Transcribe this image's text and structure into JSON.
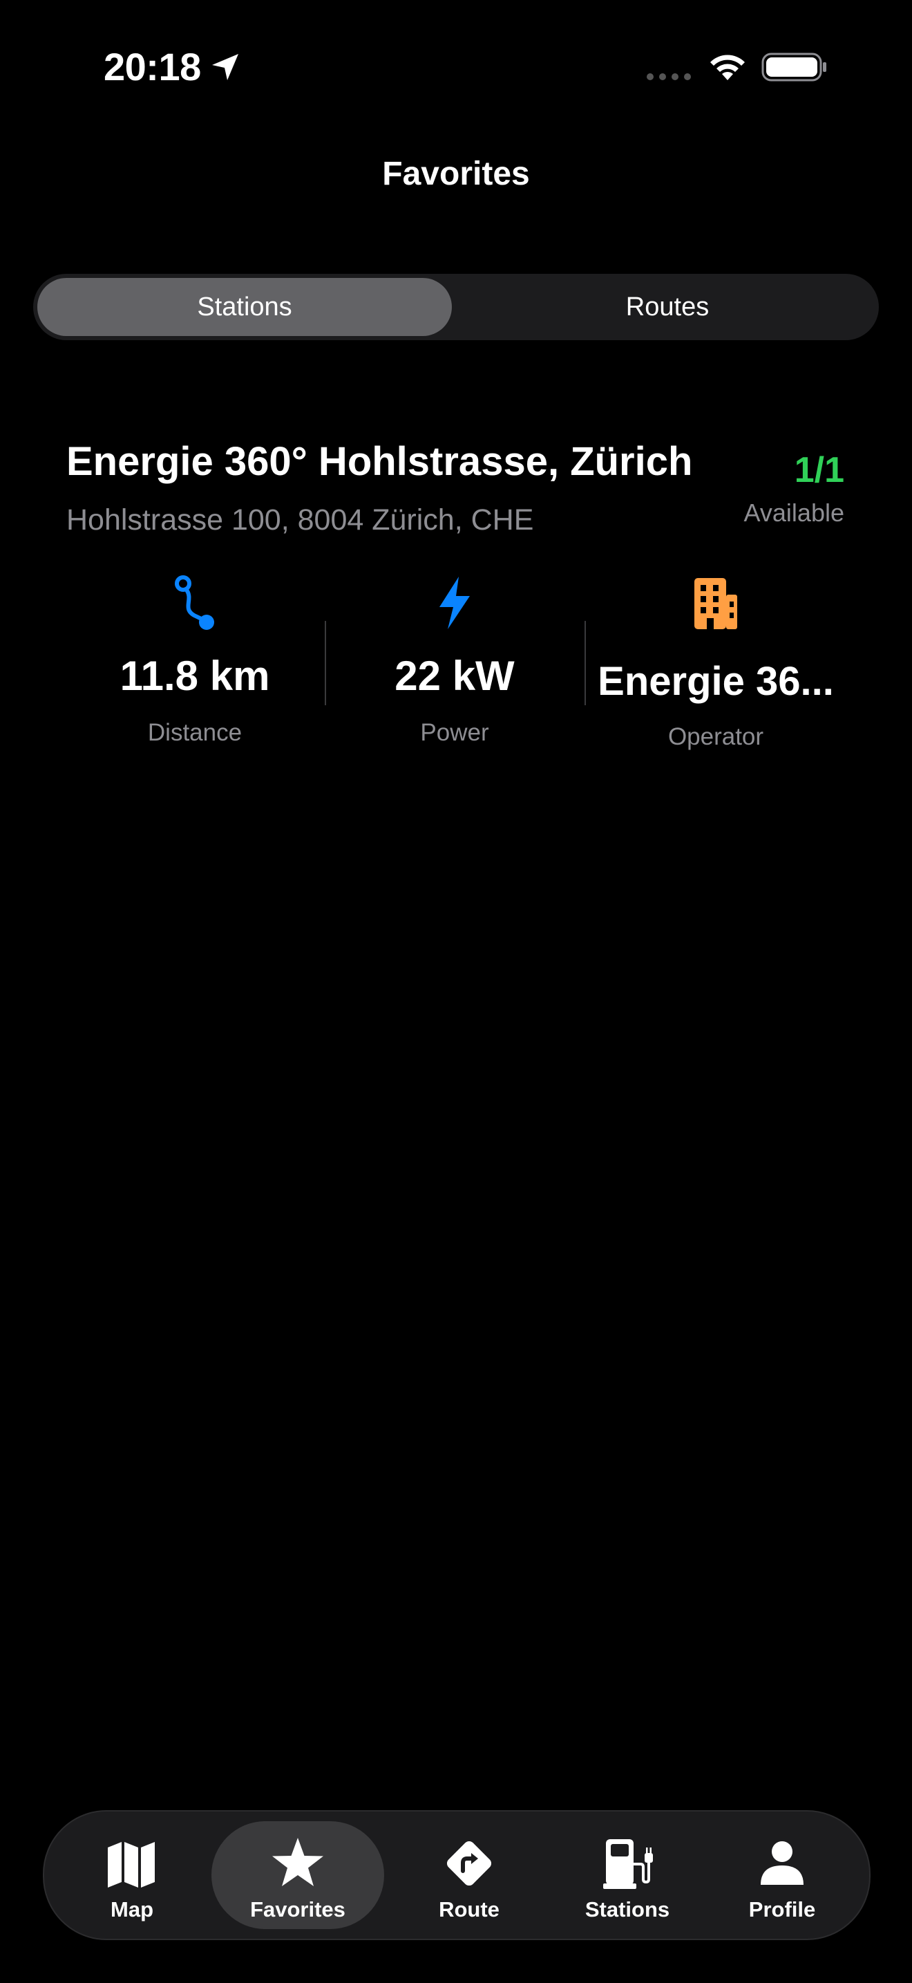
{
  "status_bar": {
    "time": "20:18"
  },
  "header": {
    "title": "Favorites"
  },
  "segmented": {
    "options": [
      "Stations",
      "Routes"
    ],
    "selected": "Stations"
  },
  "station": {
    "name": "Energie 360° Hohlstrasse, Zürich",
    "address": "Hohlstrasse 100, 8004 Zürich, CHE",
    "availability": "1/1",
    "availability_label": "Available",
    "stats": {
      "distance": {
        "value": "11.8 km",
        "label": "Distance",
        "icon": "route-icon"
      },
      "power": {
        "value": "22 kW",
        "label": "Power",
        "icon": "bolt-icon"
      },
      "operator": {
        "value": "Energie 36...",
        "label": "Operator",
        "icon": "building-icon"
      }
    }
  },
  "tab_bar": {
    "items": [
      {
        "label": "Map",
        "icon": "map-icon"
      },
      {
        "label": "Favorites",
        "icon": "star-icon"
      },
      {
        "label": "Route",
        "icon": "route-sign-icon"
      },
      {
        "label": "Stations",
        "icon": "fuel-pump-icon"
      },
      {
        "label": "Profile",
        "icon": "person-icon"
      }
    ],
    "selected": "Favorites"
  },
  "colors": {
    "background": "#000000",
    "available_green": "#30d158",
    "accent_blue": "#0a84ff",
    "operator_orange": "#ff9f43",
    "secondary_text": "#8e8e93"
  }
}
